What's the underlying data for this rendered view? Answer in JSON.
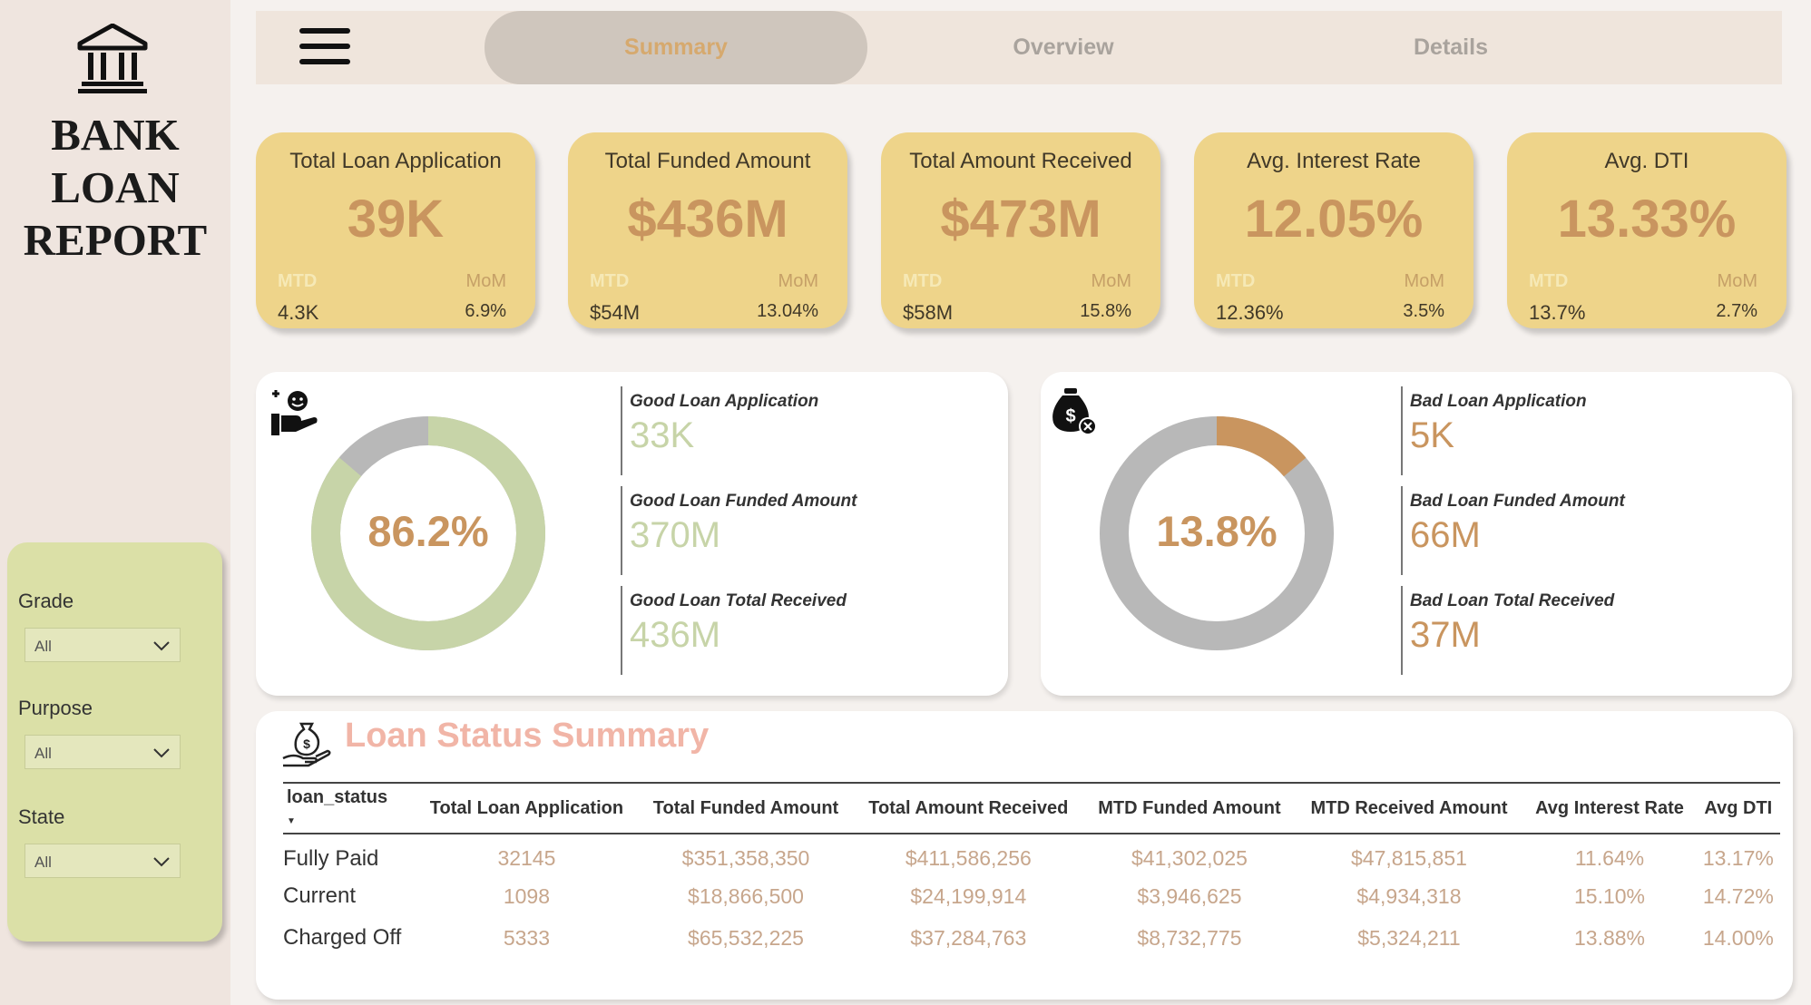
{
  "sidebar": {
    "title_lines": [
      "BANK",
      "LOAN",
      "REPORT"
    ],
    "filters": [
      {
        "label": "Grade",
        "value": "All"
      },
      {
        "label": "Purpose",
        "value": "All"
      },
      {
        "label": "State",
        "value": "All"
      }
    ]
  },
  "nav": {
    "tabs": [
      {
        "label": "Summary",
        "active": true
      },
      {
        "label": "Overview",
        "active": false
      },
      {
        "label": "Details",
        "active": false
      }
    ]
  },
  "kpis": [
    {
      "title": "Total Loan Application",
      "value": "39K",
      "mtd_label": "MTD",
      "mom_label": "MoM",
      "mtd": "4.3K",
      "mom": "6.9%"
    },
    {
      "title": "Total Funded Amount",
      "value": "$436M",
      "mtd_label": "MTD",
      "mom_label": "MoM",
      "mtd": "$54M",
      "mom": "13.04%"
    },
    {
      "title": "Total Amount Received",
      "value": "$473M",
      "mtd_label": "MTD",
      "mom_label": "MoM",
      "mtd": "$58M",
      "mom": "15.8%"
    },
    {
      "title": "Avg. Interest Rate",
      "value": "12.05%",
      "mtd_label": "MTD",
      "mom_label": "MoM",
      "mtd": "12.36%",
      "mom": "3.5%"
    },
    {
      "title": "Avg. DTI",
      "value": "13.33%",
      "mtd_label": "MTD",
      "mom_label": "MoM",
      "mtd": "13.7%",
      "mom": "2.7%"
    }
  ],
  "good_loan": {
    "percent_label": "86.2%",
    "percent": 86.2,
    "colors": {
      "main": "#c7d4a8",
      "rest": "#b8b8b8"
    },
    "metrics": [
      {
        "label": "Good Loan Application",
        "value": "33K"
      },
      {
        "label": "Good Loan Funded Amount",
        "value": "370M"
      },
      {
        "label": "Good Loan Total Received",
        "value": "436M"
      }
    ]
  },
  "bad_loan": {
    "percent_label": "13.8%",
    "percent": 13.8,
    "colors": {
      "main": "#c9955f",
      "rest": "#b8b8b8"
    },
    "metrics": [
      {
        "label": "Bad Loan Application",
        "value": "5K"
      },
      {
        "label": "Bad Loan Funded Amount",
        "value": "66M"
      },
      {
        "label": "Bad Loan Total Received",
        "value": "37M"
      }
    ]
  },
  "status_table": {
    "title": "Loan Status Summary",
    "columns": [
      "loan_status",
      "Total Loan Application",
      "Total Funded Amount",
      "Total Amount Received",
      "MTD Funded Amount",
      "MTD Received Amount",
      "Avg Interest Rate",
      "Avg DTI"
    ],
    "rows": [
      [
        "Fully Paid",
        "32145",
        "$351,358,350",
        "$411,586,256",
        "$41,302,025",
        "$47,815,851",
        "11.64%",
        "13.17%"
      ],
      [
        "Current",
        "1098",
        "$18,866,500",
        "$24,199,914",
        "$3,946,625",
        "$4,934,318",
        "15.10%",
        "14.72%"
      ],
      [
        "Charged Off",
        "5333",
        "$65,532,225",
        "$37,284,763",
        "$8,732,775",
        "$5,324,211",
        "13.88%",
        "14.00%"
      ]
    ]
  }
}
